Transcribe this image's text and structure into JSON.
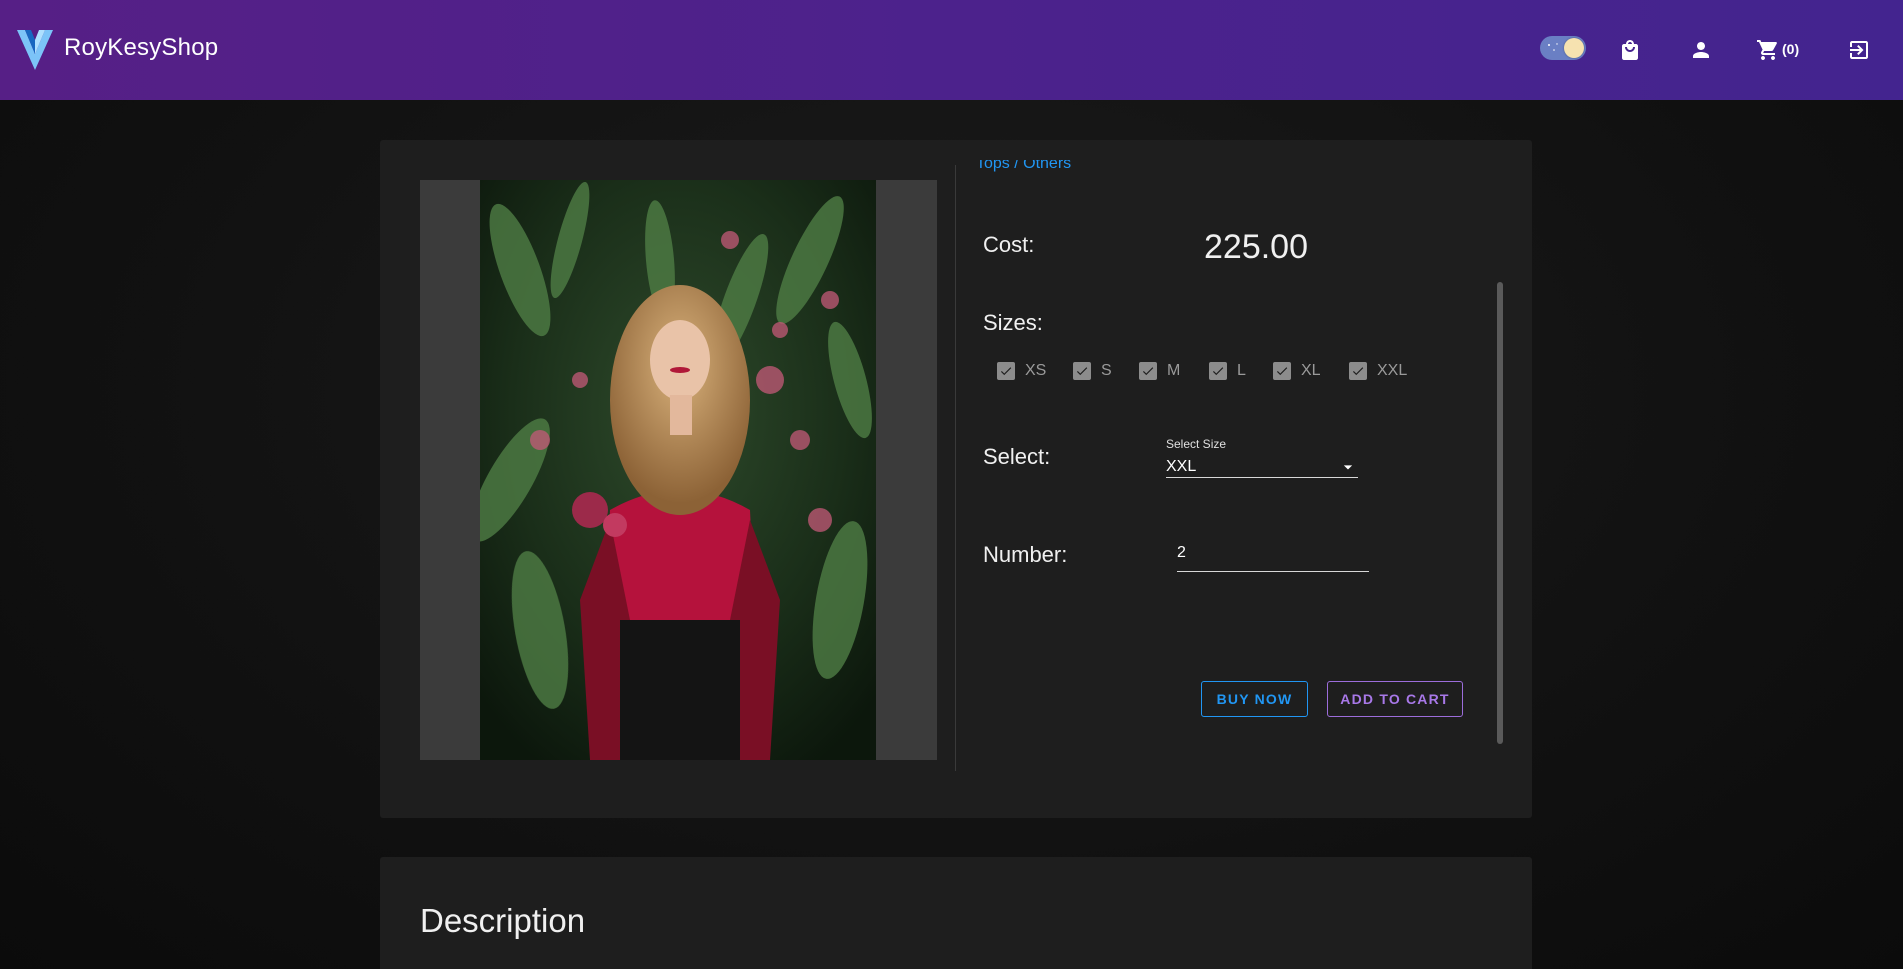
{
  "header": {
    "brand": "RoyKesyShop",
    "cart_count": "(0)",
    "icons": [
      "vuetify-logo",
      "theme-toggle",
      "shopping-bag-icon",
      "account-icon",
      "cart-icon",
      "logout-icon"
    ]
  },
  "product": {
    "breadcrumb": "Tops / Others",
    "cost_label": "Cost:",
    "cost_value": "225.00",
    "sizes_label": "Sizes:",
    "sizes": [
      {
        "label": "XS",
        "checked": true
      },
      {
        "label": "S",
        "checked": true
      },
      {
        "label": "M",
        "checked": true
      },
      {
        "label": "L",
        "checked": true
      },
      {
        "label": "XL",
        "checked": true
      },
      {
        "label": "XXL",
        "checked": true
      }
    ],
    "select_label": "Select:",
    "select_field_label": "Select Size",
    "select_value": "XXL",
    "number_label": "Number:",
    "number_value": "2",
    "buy_now": "BUY NOW",
    "add_to_cart": "ADD TO CART"
  },
  "description": {
    "title": "Description"
  },
  "colors": {
    "header_start": "#561f86",
    "header_end": "#43248f",
    "primary": "#2196f3",
    "accent": "#a878e8"
  }
}
